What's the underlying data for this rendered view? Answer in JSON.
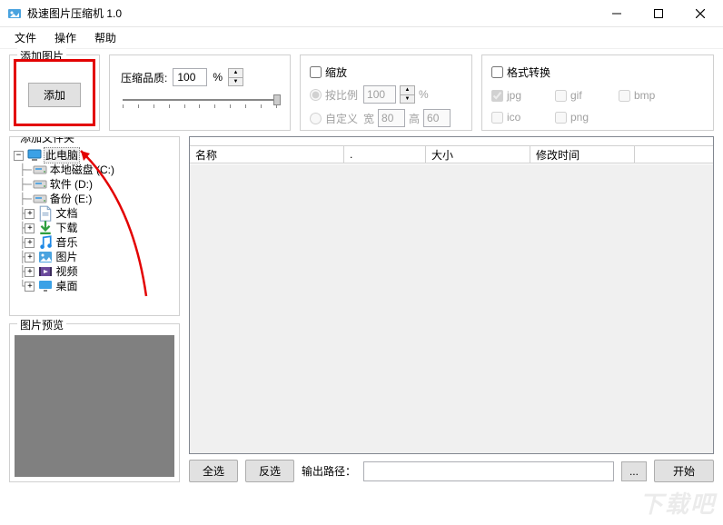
{
  "window": {
    "title": "极速图片压缩机 1.0"
  },
  "menu": {
    "file": "文件",
    "op": "操作",
    "help": "帮助"
  },
  "add_group": {
    "legend": "添加图片",
    "button": "添加"
  },
  "quality": {
    "label": "压缩品质:",
    "value": "100",
    "unit": "%"
  },
  "scale": {
    "title": "缩放",
    "by_ratio": "按比例",
    "ratio_value": "100",
    "ratio_unit": "%",
    "custom": "自定义",
    "w_label": "宽",
    "w_value": "80",
    "h_label": "高",
    "h_value": "60"
  },
  "format": {
    "title": "格式转换",
    "jpg": "jpg",
    "gif": "gif",
    "bmp": "bmp",
    "ico": "ico",
    "png": "png"
  },
  "folder": {
    "legend": "添加文件夹",
    "root": "此电脑",
    "items": [
      {
        "label": "本地磁盘 (C:)",
        "icon": "disk",
        "expandable": false
      },
      {
        "label": "软件 (D:)",
        "icon": "disk",
        "expandable": false
      },
      {
        "label": "备份 (E:)",
        "icon": "disk",
        "expandable": false
      },
      {
        "label": "文档",
        "icon": "doc",
        "expandable": true
      },
      {
        "label": "下载",
        "icon": "download",
        "expandable": true
      },
      {
        "label": "音乐",
        "icon": "music",
        "expandable": true
      },
      {
        "label": "图片",
        "icon": "image",
        "expandable": true
      },
      {
        "label": "视频",
        "icon": "video",
        "expandable": true
      },
      {
        "label": "桌面",
        "icon": "desktop",
        "expandable": true
      }
    ]
  },
  "preview": {
    "legend": "图片预览"
  },
  "table": {
    "c1": "名称",
    "c2": ".",
    "c3": "大小",
    "c4": "修改时间"
  },
  "bottom": {
    "select_all": "全选",
    "invert": "反选",
    "out_label": "输出路径：",
    "browse": "...",
    "start": "开始"
  },
  "watermark": "下载吧"
}
